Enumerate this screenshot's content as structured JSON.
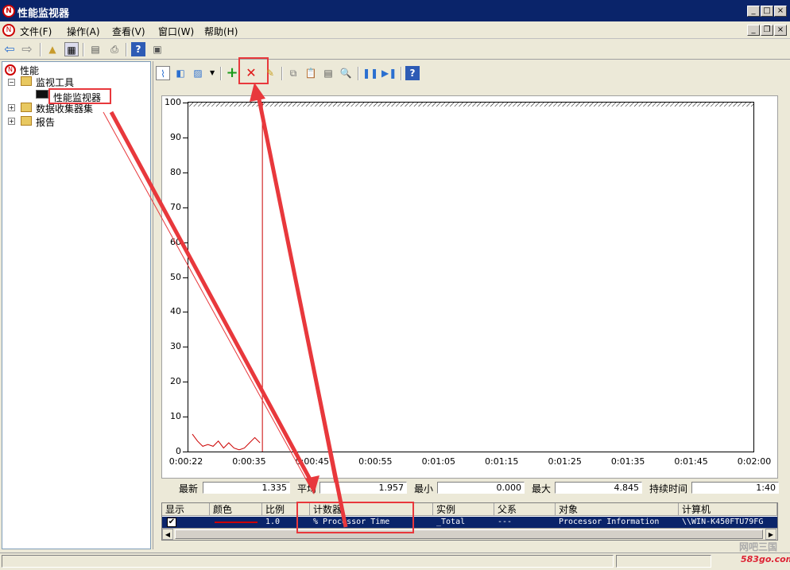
{
  "window": {
    "title": "性能监视器"
  },
  "menu": [
    "文件(F)",
    "操作(A)",
    "查看(V)",
    "窗口(W)",
    "帮助(H)"
  ],
  "tree": {
    "root": "性能",
    "monitor_tools": "监视工具",
    "perf_monitor": "性能监视器",
    "data_collectors": "数据收集器集",
    "reports": "报告"
  },
  "chart_data": {
    "type": "line",
    "y_ticks": [
      "100",
      "90",
      "80",
      "70",
      "60",
      "50",
      "40",
      "30",
      "20",
      "10",
      "0"
    ],
    "x_ticks": [
      "0:00:22",
      "0:00:35",
      "0:00:45",
      "0:00:55",
      "0:01:05",
      "0:01:15",
      "0:01:25",
      "0:01:35",
      "0:01:45",
      "0:02:00"
    ],
    "ylim": [
      0,
      100
    ],
    "series": [
      {
        "color": "#cc0000",
        "values": [
          5,
          3,
          1.5,
          2,
          1.5,
          3,
          1,
          2.5,
          1,
          0.5,
          1,
          2.5,
          4,
          2.5
        ]
      }
    ],
    "cursor_x": 0.131
  },
  "stats": {
    "last_label": "最新",
    "last": "1.335",
    "avg_label": "平均",
    "avg": "1.957",
    "min_label": "最小",
    "min": "0.000",
    "max_label": "最大",
    "max": "4.845",
    "dur_label": "持续时间",
    "dur": "1:40"
  },
  "counters": {
    "headers": [
      "显示",
      "颜色",
      "比例",
      "计数器",
      "实例",
      "父系",
      "对象",
      "计算机"
    ],
    "row": {
      "scale": "1.0",
      "counter": "% Processor Time",
      "instance": "_Total",
      "parent": "---",
      "object": "Processor Information",
      "computer": "\\\\WIN-K450FTU79FG"
    }
  },
  "watermark": {
    "text": "网吧三国",
    "url": "583go.com"
  }
}
